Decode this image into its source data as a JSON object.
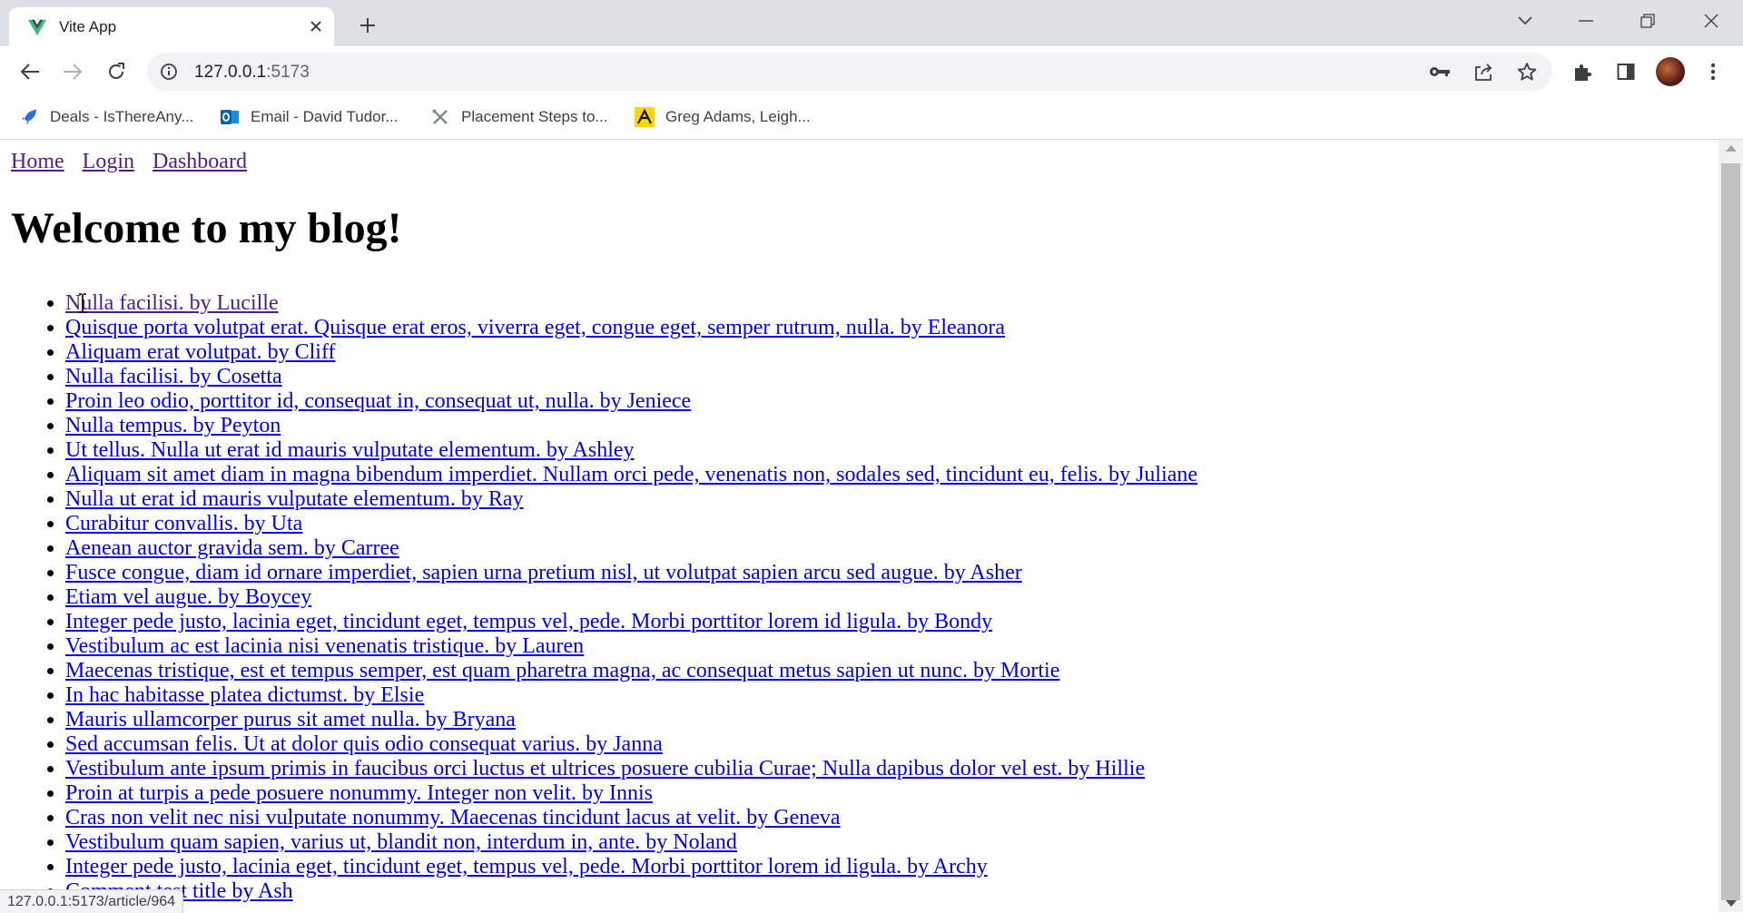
{
  "browser": {
    "tab_title": "Vite App",
    "url_host": "127.0.0.1",
    "url_port": ":5173",
    "bookmarks": [
      {
        "label": "Deals - IsThereAny...",
        "icon": "rocket-icon"
      },
      {
        "label": "Email - David Tudor...",
        "icon": "outlook-icon"
      },
      {
        "label": "Placement Steps to...",
        "icon": "tools-icon"
      },
      {
        "label": "Greg Adams, Leigh...",
        "icon": "yellow-pages-icon"
      }
    ],
    "status_url": "127.0.0.1:5173/article/964"
  },
  "nav": {
    "home": "Home",
    "login": "Login",
    "dashboard": "Dashboard"
  },
  "heading": "Welcome to my blog!",
  "articles": [
    "Nulla facilisi. by Lucille",
    "Quisque porta volutpat erat. Quisque erat eros, viverra eget, congue eget, semper rutrum, nulla. by Eleanora",
    "Aliquam erat volutpat. by Cliff",
    "Nulla facilisi. by Cosetta",
    "Proin leo odio, porttitor id, consequat in, consequat ut, nulla. by Jeniece",
    "Nulla tempus. by Peyton",
    "Ut tellus. Nulla ut erat id mauris vulputate elementum. by Ashley",
    "Aliquam sit amet diam in magna bibendum imperdiet. Nullam orci pede, venenatis non, sodales sed, tincidunt eu, felis. by Juliane",
    "Nulla ut erat id mauris vulputate elementum. by Ray",
    "Curabitur convallis. by Uta",
    "Aenean auctor gravida sem. by Carree",
    "Fusce congue, diam id ornare imperdiet, sapien urna pretium nisl, ut volutpat sapien arcu sed augue. by Asher",
    "Etiam vel augue. by Boycey",
    "Integer pede justo, lacinia eget, tincidunt eget, tempus vel, pede. Morbi porttitor lorem id ligula. by Bondy",
    "Vestibulum ac est lacinia nisi venenatis tristique. by Lauren",
    "Maecenas tristique, est et tempus semper, est quam pharetra magna, ac consequat metus sapien ut nunc. by Mortie",
    "In hac habitasse platea dictumst. by Elsie",
    "Mauris ullamcorper purus sit amet nulla. by Bryana",
    "Sed accumsan felis. Ut at dolor quis odio consequat varius. by Janna",
    "Vestibulum ante ipsum primis in faucibus orci luctus et ultrices posuere cubilia Curae; Nulla dapibus dolor vel est. by Hillie",
    "Proin at turpis a pede posuere nonummy. Integer non velit. by Innis",
    "Cras non velit nec nisi vulputate nonummy. Maecenas tincidunt lacus at velit. by Geneva",
    "Vestibulum quam sapien, varius ut, blandit non, interdum in, ante. by Noland",
    "Integer pede justo, lacinia eget, tincidunt eget, tempus vel, pede. Morbi porttitor lorem id ligula. by Archy",
    "Comment test title by Ash"
  ],
  "colors": {
    "link": "#0000ee",
    "visited_link": "#551a8b",
    "tabstrip": "#dee1e6"
  }
}
